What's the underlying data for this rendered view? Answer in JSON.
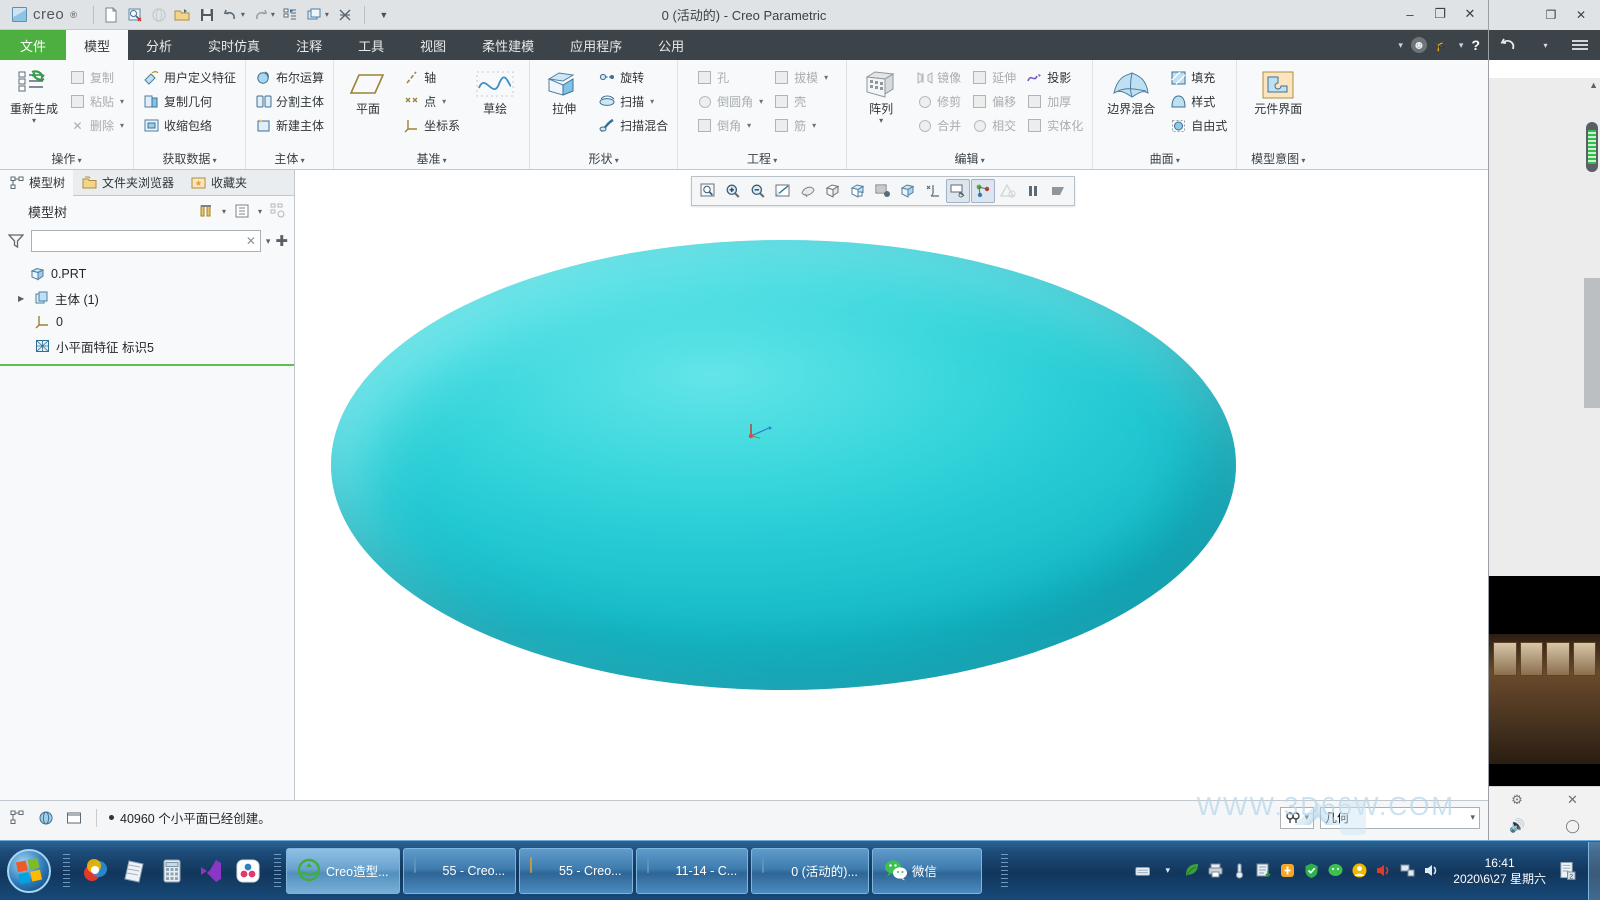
{
  "window": {
    "title": "0 (活动的) - Creo Parametric",
    "brand": "creo",
    "minimize": "–",
    "maximize": "❐",
    "close": "✕"
  },
  "quick_access": {
    "icons": [
      {
        "name": "new-file-icon",
        "glyph": "🗋",
        "enabled": true
      },
      {
        "name": "open-preview-icon",
        "glyph": "🔍",
        "enabled": true
      },
      {
        "name": "open-web-icon",
        "glyph": "◍",
        "enabled": false
      },
      {
        "name": "open-folder-icon",
        "glyph": "📂",
        "enabled": true
      },
      {
        "name": "save-icon",
        "glyph": "💾",
        "enabled": true
      },
      {
        "name": "undo-icon",
        "glyph": "↶",
        "enabled": true
      },
      {
        "name": "redo-icon",
        "glyph": "↷",
        "enabled": true
      },
      {
        "name": "regenerate-icon",
        "glyph": "⇄",
        "enabled": true
      },
      {
        "name": "window-icon",
        "glyph": "❐",
        "enabled": true
      },
      {
        "name": "close-window-icon",
        "glyph": "⨳",
        "enabled": true
      },
      {
        "name": "customize-qa-icon",
        "glyph": "▾",
        "enabled": true
      }
    ]
  },
  "tabs": [
    {
      "label": "文件",
      "name": "tab-file",
      "state": "file"
    },
    {
      "label": "模型",
      "name": "tab-model",
      "state": "active"
    },
    {
      "label": "分析",
      "name": "tab-analysis",
      "state": ""
    },
    {
      "label": "实时仿真",
      "name": "tab-simulation",
      "state": ""
    },
    {
      "label": "注释",
      "name": "tab-annotate",
      "state": ""
    },
    {
      "label": "工具",
      "name": "tab-tools",
      "state": ""
    },
    {
      "label": "视图",
      "name": "tab-view",
      "state": ""
    },
    {
      "label": "柔性建模",
      "name": "tab-flexible-modeling",
      "state": ""
    },
    {
      "label": "应用程序",
      "name": "tab-applications",
      "state": ""
    },
    {
      "label": "公用",
      "name": "tab-common",
      "state": ""
    }
  ],
  "tab_right": {
    "help": "?",
    "minimize_ribbon": "▾"
  },
  "ribbon": {
    "groups": [
      {
        "name": "operations",
        "title": "操作",
        "big": {
          "label": "重新生成",
          "icon": "regenerate-icon",
          "caret": "▾"
        },
        "columns": [
          [
            {
              "label": "复制",
              "icon": "copy-icon",
              "enabled": false,
              "caret": ""
            },
            {
              "label": "粘贴",
              "icon": "paste-icon",
              "enabled": false,
              "caret": "▾"
            },
            {
              "label": "删除",
              "icon": "delete-icon",
              "enabled": false,
              "caret": "▾"
            }
          ]
        ]
      },
      {
        "name": "get-data",
        "title": "获取数据",
        "columns": [
          [
            {
              "label": "用户定义特征",
              "icon": "udf-icon",
              "enabled": true,
              "caret": ""
            },
            {
              "label": "复制几何",
              "icon": "copy-geometry-icon",
              "enabled": true,
              "caret": ""
            },
            {
              "label": "收缩包络",
              "icon": "shrinkwrap-icon",
              "enabled": true,
              "caret": ""
            }
          ]
        ]
      },
      {
        "name": "body",
        "title": "主体",
        "columns": [
          [
            {
              "label": "布尔运算",
              "icon": "boolean-icon",
              "enabled": true,
              "caret": ""
            },
            {
              "label": "分割主体",
              "icon": "split-body-icon",
              "enabled": true,
              "caret": ""
            },
            {
              "label": "新建主体",
              "icon": "new-body-icon",
              "enabled": true,
              "caret": ""
            }
          ]
        ]
      },
      {
        "name": "datum",
        "title": "基准",
        "big": {
          "label": "平面",
          "icon": "datum-plane-icon",
          "caret": ""
        },
        "columns": [
          [
            {
              "label": "轴",
              "icon": "datum-axis-icon",
              "enabled": true,
              "caret": ""
            },
            {
              "label": "点",
              "icon": "datum-point-icon",
              "enabled": true,
              "caret": "▾"
            },
            {
              "label": "坐标系",
              "icon": "coordinate-system-icon",
              "enabled": true,
              "caret": ""
            }
          ]
        ],
        "big2": {
          "label": "草绘",
          "icon": "sketch-icon",
          "caret": ""
        }
      },
      {
        "name": "shapes",
        "title": "形状",
        "big": {
          "label": "拉伸",
          "icon": "extrude-icon",
          "caret": ""
        },
        "columns": [
          [
            {
              "label": "旋转",
              "icon": "revolve-icon",
              "enabled": true,
              "caret": ""
            },
            {
              "label": "扫描",
              "icon": "sweep-icon",
              "enabled": true,
              "caret": "▾"
            },
            {
              "label": "扫描混合",
              "icon": "swept-blend-icon",
              "enabled": true,
              "caret": ""
            }
          ]
        ]
      },
      {
        "name": "engineering",
        "title": "工程",
        "columns": [
          [
            {
              "label": "孔",
              "icon": "hole-icon",
              "enabled": false,
              "caret": ""
            },
            {
              "label": "倒圆角",
              "icon": "round-icon",
              "enabled": false,
              "caret": "▾"
            },
            {
              "label": "倒角",
              "icon": "chamfer-icon",
              "enabled": false,
              "caret": "▾"
            }
          ],
          [
            {
              "label": "拔模",
              "icon": "draft-icon",
              "enabled": false,
              "caret": "▾"
            },
            {
              "label": "壳",
              "icon": "shell-icon",
              "enabled": false,
              "caret": ""
            },
            {
              "label": "筋",
              "icon": "rib-icon",
              "enabled": false,
              "caret": "▾"
            }
          ]
        ]
      },
      {
        "name": "editing",
        "title": "编辑",
        "big": {
          "label": "阵列",
          "icon": "pattern-icon",
          "caret": "▾"
        },
        "columns": [
          [
            {
              "label": "镜像",
              "icon": "mirror-icon",
              "enabled": false,
              "caret": ""
            },
            {
              "label": "修剪",
              "icon": "trim-icon",
              "enabled": false,
              "caret": ""
            },
            {
              "label": "合并",
              "icon": "merge-icon",
              "enabled": false,
              "caret": ""
            }
          ],
          [
            {
              "label": "延伸",
              "icon": "extend-icon",
              "enabled": false,
              "caret": ""
            },
            {
              "label": "偏移",
              "icon": "offset-icon",
              "enabled": false,
              "caret": ""
            },
            {
              "label": "相交",
              "icon": "intersect-icon",
              "enabled": false,
              "caret": ""
            }
          ],
          [
            {
              "label": "投影",
              "icon": "project-icon",
              "enabled": true,
              "caret": ""
            },
            {
              "label": "加厚",
              "icon": "thicken-icon",
              "enabled": false,
              "caret": ""
            },
            {
              "label": "实体化",
              "icon": "solidify-icon",
              "enabled": false,
              "caret": ""
            }
          ]
        ]
      },
      {
        "name": "surfaces",
        "title": "曲面",
        "big": {
          "label": "边界混合",
          "icon": "boundary-blend-icon",
          "caret": ""
        },
        "columns": [
          [
            {
              "label": "填充",
              "icon": "fill-icon",
              "enabled": true,
              "caret": ""
            },
            {
              "label": "样式",
              "icon": "style-icon",
              "enabled": true,
              "caret": ""
            },
            {
              "label": "自由式",
              "icon": "freestyle-icon",
              "enabled": true,
              "caret": ""
            }
          ]
        ]
      },
      {
        "name": "model-intent",
        "title": "模型意图",
        "big": {
          "label": "元件界面",
          "icon": "component-interface-icon",
          "caret": ""
        }
      }
    ]
  },
  "navigator": {
    "tabs": [
      {
        "label": "模型树",
        "name": "nav-tab-model-tree",
        "icon": "model-tree-icon",
        "active": true
      },
      {
        "label": "文件夹浏览器",
        "name": "nav-tab-folder-browser",
        "icon": "folder-icon",
        "active": false
      },
      {
        "label": "收藏夹",
        "name": "nav-tab-favorites",
        "icon": "favorites-icon",
        "active": false
      }
    ],
    "header_title": "模型树",
    "header_icons": [
      {
        "name": "tools-icon",
        "glyph": "🛠"
      },
      {
        "name": "settings-list-icon",
        "glyph": "▤"
      },
      {
        "name": "tree-filter-icon",
        "glyph": "▦"
      }
    ],
    "filter": {
      "value": "",
      "placeholder": "",
      "clear": "✕",
      "dropdown": "▾",
      "add": "✚"
    },
    "tree": [
      {
        "label": "0.PRT",
        "icon": "part-icon",
        "indent": 0,
        "arrow": ""
      },
      {
        "label": "主体 (1)",
        "icon": "body-icon",
        "indent": 1,
        "arrow": "▶"
      },
      {
        "label": "0",
        "icon": "coordinate-system-icon",
        "indent": 2,
        "arrow": ""
      },
      {
        "label": "小平面特征 标识5",
        "icon": "facet-feature-icon",
        "indent": 2,
        "arrow": ""
      }
    ]
  },
  "graphics_toolbar": [
    {
      "name": "zoom-window-icon",
      "glyph": "⌕",
      "state": ""
    },
    {
      "name": "zoom-in-icon",
      "glyph": "⊕",
      "state": ""
    },
    {
      "name": "zoom-out-icon",
      "glyph": "⊖",
      "state": ""
    },
    {
      "name": "refit-icon",
      "glyph": "◩",
      "state": ""
    },
    {
      "name": "reorient-icon",
      "glyph": "◒",
      "state": ""
    },
    {
      "name": "saved-views-icon",
      "glyph": "▣",
      "state": ""
    },
    {
      "name": "view-manager-icon",
      "glyph": "⬒",
      "state": ""
    },
    {
      "name": "layers-icon",
      "glyph": "▤",
      "state": ""
    },
    {
      "name": "display-style-icon",
      "glyph": "◫",
      "state": ""
    },
    {
      "name": "datum-display-icon",
      "glyph": "✛",
      "state": ""
    },
    {
      "name": "annotation-display-icon",
      "glyph": "▭",
      "state": "on"
    },
    {
      "name": "spin-center-icon",
      "glyph": "⁂",
      "state": "on"
    },
    {
      "name": "appearance-icon",
      "glyph": "◬",
      "state": "dim"
    },
    {
      "name": "pause-icon",
      "glyph": "❚❚",
      "state": ""
    },
    {
      "name": "stop-icon",
      "glyph": "◣",
      "state": ""
    }
  ],
  "model": {
    "color": "#2ecfd8",
    "name": "facet-solid-ellipsoid",
    "csys_label": "0"
  },
  "status_bar": {
    "icons": [
      {
        "name": "model-tree-status-icon",
        "glyph": "▦"
      },
      {
        "name": "browser-status-icon",
        "glyph": "◍"
      },
      {
        "name": "window-status-icon",
        "glyph": "▭"
      }
    ],
    "message": "40960 个小平面已经创建。",
    "right": {
      "selection_filter_icon": "selection-filter-icon",
      "selection_filter_glyph": "⚲",
      "selection_filter_caret": "▾",
      "geometry_label": "几何",
      "geometry_caret": "▾"
    }
  },
  "desktop_panel": {
    "title_icons": [
      {
        "name": "restore-icon",
        "glyph": "❐"
      },
      {
        "name": "close-icon",
        "glyph": "✕"
      }
    ],
    "back_icon": "back-arrow-icon",
    "back_caret": "▾",
    "menu_icon": "hamburger-menu-icon",
    "panel_footer": [
      {
        "name": "settings-gear-icon",
        "glyph": "⚙"
      },
      {
        "name": "close-panel-icon",
        "glyph": "✕"
      }
    ],
    "bottom_icons": [
      {
        "name": "gear-icon",
        "glyph": "⚙"
      },
      {
        "name": "volume-icon",
        "glyph": "🔊"
      },
      {
        "name": "circle-icon",
        "glyph": "◯"
      }
    ]
  },
  "taskbar": {
    "start": "start-orb",
    "quick_launch": [
      {
        "name": "ql-media-icon",
        "glyph": "◉"
      },
      {
        "name": "ql-notepad-icon",
        "glyph": "▤"
      },
      {
        "name": "ql-calculator-icon",
        "glyph": "▥"
      },
      {
        "name": "ql-visual-studio-icon",
        "glyph": "◤"
      },
      {
        "name": "ql-atom-icon",
        "glyph": "❀"
      }
    ],
    "buttons": [
      {
        "label": "Creo造型...",
        "name": "taskbtn-creo-modeling",
        "icon": "creo-ie-icon",
        "active": true,
        "doc": "green"
      },
      {
        "label": "55 - Creo...",
        "name": "taskbtn-55-creo-1",
        "icon": "creo-doc-icon",
        "active": false,
        "doc": "blue"
      },
      {
        "label": "55 - Creo...",
        "name": "taskbtn-55-creo-2",
        "icon": "creo-doc-icon",
        "active": false,
        "doc": "yellow"
      },
      {
        "label": "11-14 - C...",
        "name": "taskbtn-11-14",
        "icon": "creo-doc-icon",
        "active": false,
        "doc": "blue"
      },
      {
        "label": "0 (活动的)...",
        "name": "taskbtn-0-active",
        "icon": "creo-doc-icon",
        "active": false,
        "doc": "blue"
      },
      {
        "label": "微信",
        "name": "taskbtn-wechat",
        "icon": "wechat-icon",
        "active": false,
        "doc": "wechat"
      }
    ],
    "tray": [
      {
        "name": "tray-ime-icon",
        "glyph": "⌨"
      },
      {
        "name": "tray-ime-caret-icon",
        "glyph": "▾"
      },
      {
        "name": "tray-leaf-icon",
        "glyph": "🍃"
      },
      {
        "name": "tray-printer-icon",
        "glyph": "🖨"
      },
      {
        "name": "tray-thermometer-icon",
        "glyph": "🌡"
      },
      {
        "name": "tray-download-icon",
        "glyph": "▤"
      },
      {
        "name": "tray-shield-orange-icon",
        "glyph": "◍"
      },
      {
        "name": "tray-shield-green-icon",
        "glyph": "⛨"
      },
      {
        "name": "tray-wechat-icon",
        "glyph": "◉"
      },
      {
        "name": "tray-person-icon",
        "glyph": "☻"
      },
      {
        "name": "tray-speaker-red-icon",
        "glyph": "🔊"
      },
      {
        "name": "tray-network-icon",
        "glyph": "🖧"
      },
      {
        "name": "tray-volume-icon",
        "glyph": "🔈"
      }
    ],
    "clock": {
      "time": "16:41",
      "date": "2020\\6\\27 星期六"
    },
    "show_desktop": "show-desktop-button"
  },
  "watermark": {
    "text": "WWW.3D66W.COM"
  }
}
